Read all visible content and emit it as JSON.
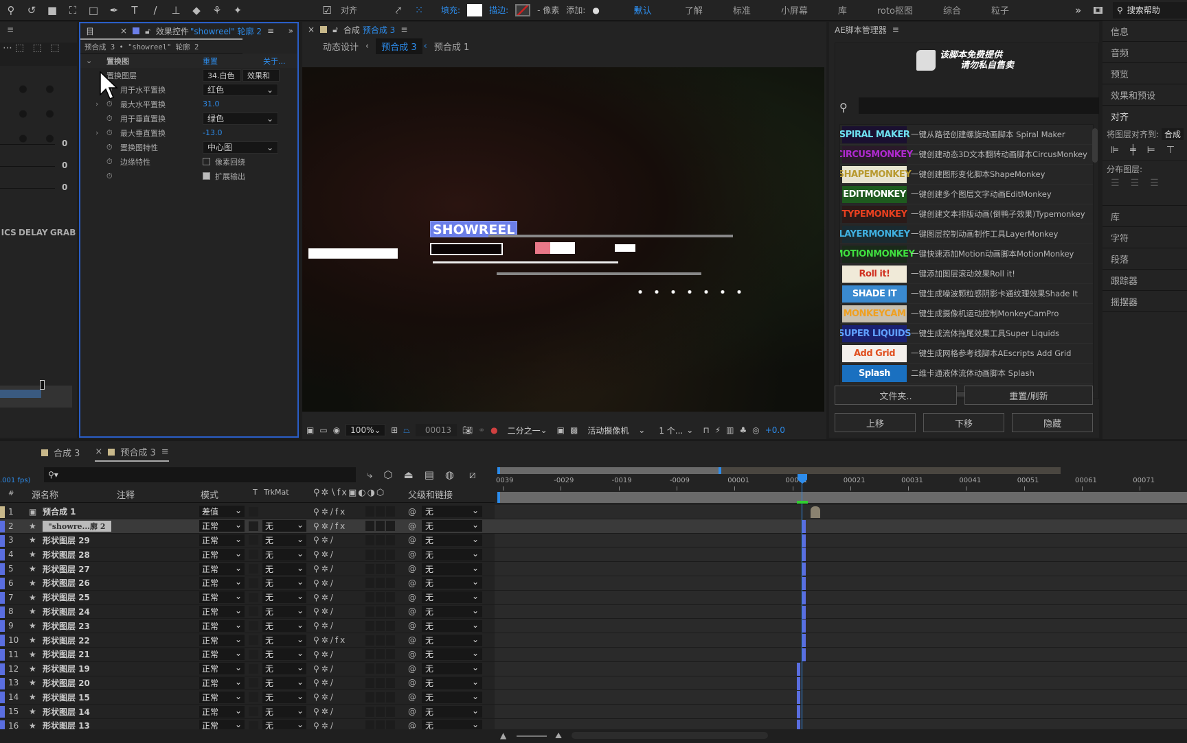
{
  "toolbar": {
    "align_label": "对齐",
    "fill_label": "填充:",
    "stroke_label": "描边:",
    "stroke_unit": "- 像素",
    "add_label": "添加:",
    "workspaces": [
      "默认",
      "了解",
      "标准",
      "小屏幕",
      "库",
      "roto抠图",
      "综合",
      "粒子"
    ],
    "active_workspace": "默认",
    "more": "»",
    "search_placeholder": "搜索帮助"
  },
  "left_panel": {
    "values": [
      "0",
      "0",
      "0"
    ],
    "buttons": [
      "ICS",
      "DELAY",
      "GRAB"
    ]
  },
  "effects_panel": {
    "tab_title": "效果控件",
    "tab_layer": "\"showreel\" 轮廓 2",
    "breadcrumb": "预合成 3 • \"showreel\" 轮廓 2",
    "effect_name": "置换图",
    "reset": "重置",
    "about": "关于...",
    "props": [
      {
        "label": "置换图层",
        "value": "34.白色",
        "value2": "效果和",
        "type": "dd2"
      },
      {
        "label": "用于水平置换",
        "value": "红色",
        "type": "dd"
      },
      {
        "label": "最大水平置换",
        "value": "31.0",
        "type": "num"
      },
      {
        "label": "用于垂直置换",
        "value": "绿色",
        "type": "dd"
      },
      {
        "label": "最大垂直置换",
        "value": "-13.0",
        "type": "num"
      },
      {
        "label": "置换图特性",
        "value": "中心图",
        "type": "dd"
      },
      {
        "label": "边缘特性",
        "value": "像素回绕",
        "type": "cb",
        "checked": false
      },
      {
        "label": "",
        "value": "扩展输出",
        "type": "cb",
        "checked": true
      }
    ]
  },
  "comp_panel": {
    "tab_prefix": "合成",
    "tab_name": "预合成 3",
    "breadcrumbs": [
      "动态设计",
      "预合成 3",
      "预合成 1"
    ],
    "showreel_text": "SHOWREEL",
    "zoom": "100%",
    "timecode": "00013",
    "resolution": "二分之一",
    "camera": "活动摄像机",
    "views": "1 个...",
    "exposure": "+0.0"
  },
  "script_manager": {
    "title": "AE脚本管理器",
    "banner_line1": "该脚本免费提供",
    "banner_line2": "请勿私自售卖",
    "search_value": "",
    "items": [
      {
        "thumb": "SPIRAL MAKER",
        "thumb_bg": "#1a1030",
        "thumb_fg": "#6ee0f0",
        "desc": "一键从路径创建螺旋动画脚本 Spiral Maker"
      },
      {
        "thumb": "CIRCUSMONKEY",
        "thumb_bg": "#2a1a2a",
        "thumb_fg": "#b02ad0",
        "desc": "一键创建动态3D文本翻转动画脚本CircusMonkey"
      },
      {
        "thumb": "SHAPEMONKEY",
        "thumb_bg": "#e8e4d0",
        "thumb_fg": "#b89a30",
        "desc": "一键创建图形变化脚本ShapeMonkey"
      },
      {
        "thumb": "EDITMONKEY",
        "thumb_bg": "#1e5a1e",
        "thumb_fg": "#ffffff",
        "desc": "一键创建多个图层文字动画EditMonkey"
      },
      {
        "thumb": "TYPEMONKEY",
        "thumb_bg": "#2a1a18",
        "thumb_fg": "#e84020",
        "desc": "一键创建文本排版动画(倒鸭子效果)Typemonkey"
      },
      {
        "thumb": "LAYERMONKEY",
        "thumb_bg": "#1a2a30",
        "thumb_fg": "#40b0e0",
        "desc": "一键图层控制动画制作工具LayerMonkey"
      },
      {
        "thumb": "MOTIONMONKEY",
        "thumb_bg": "#1a2a1a",
        "thumb_fg": "#40e040",
        "desc": "一键快速添加Motion动画脚本MotionMonkey"
      },
      {
        "thumb": "Roll it!",
        "thumb_bg": "#f0ead8",
        "thumb_fg": "#d03020",
        "desc": "一键添加图层滚动效果Roll it!"
      },
      {
        "thumb": "SHADE IT",
        "thumb_bg": "#3a8ad0",
        "thumb_fg": "#ffffff",
        "desc": "一键生成噪波颗粒感阴影卡通纹理效果Shade It"
      },
      {
        "thumb": "MONKEYCAM",
        "thumb_bg": "#c8c0b0",
        "thumb_fg": "#f0a020",
        "desc": "一键生成摄像机运动控制MonkeyCamPro"
      },
      {
        "thumb": "SUPER LIQUIDS",
        "thumb_bg": "#1a2070",
        "thumb_fg": "#60a0ff",
        "desc": "一键生成流体拖尾效果工具Super Liquids"
      },
      {
        "thumb": "Add Grid",
        "thumb_bg": "#f4f0ec",
        "thumb_fg": "#e05020",
        "desc": "一键生成网格参考线脚本AEscripts Add Grid"
      },
      {
        "thumb": "Splash",
        "thumb_bg": "#1a70c0",
        "thumb_fg": "#ffffff",
        "desc": "二维卡通液体流体动画脚本 Splash"
      }
    ],
    "buttons": {
      "folder": "文件夹..",
      "reset": "重置/刷新",
      "up": "上移",
      "down": "下移",
      "hide": "隐藏"
    }
  },
  "right_panel": {
    "items_top": [
      "信息",
      "音频",
      "预览",
      "效果和预设"
    ],
    "align_title": "对齐",
    "align_to_label": "将图层对齐到:",
    "align_to_value": "合成",
    "distribute_label": "分布图层:",
    "items_bottom": [
      "库",
      "字符",
      "段落",
      "跟踪器",
      "摇摆器"
    ]
  },
  "timeline": {
    "tabs": [
      {
        "label": "合成 3",
        "active": false
      },
      {
        "label": "预合成 3",
        "active": true
      }
    ],
    "fps": ".001 fps)",
    "search_value": "",
    "columns": {
      "num": "#",
      "source": "源名称",
      "comment": "注释",
      "mode": "模式",
      "t": "T",
      "trkmat": "TrkMat",
      "parent": "父级和链接"
    },
    "ruler": [
      "0039",
      "-0029",
      "-0019",
      "-0009",
      "00001",
      "00011",
      "00021",
      "00031",
      "00041",
      "00051",
      "00061",
      "00071"
    ],
    "current_frame": "00013",
    "layers": [
      {
        "num": "1",
        "name": "预合成 1",
        "mode": "差值",
        "trkmat": "",
        "fx": true,
        "parent": "无",
        "type": "comp"
      },
      {
        "num": "2",
        "name": "\"showre...廓 2",
        "mode": "正常",
        "trkmat": "无",
        "fx": true,
        "parent": "无",
        "type": "shape",
        "selected": true
      },
      {
        "num": "3",
        "name": "形状图层 29",
        "mode": "正常",
        "trkmat": "无",
        "fx": false,
        "parent": "无",
        "type": "shape"
      },
      {
        "num": "4",
        "name": "形状图层 28",
        "mode": "正常",
        "trkmat": "无",
        "fx": false,
        "parent": "无",
        "type": "shape"
      },
      {
        "num": "5",
        "name": "形状图层 27",
        "mode": "正常",
        "trkmat": "无",
        "fx": false,
        "parent": "无",
        "type": "shape"
      },
      {
        "num": "6",
        "name": "形状图层 26",
        "mode": "正常",
        "trkmat": "无",
        "fx": false,
        "parent": "无",
        "type": "shape"
      },
      {
        "num": "7",
        "name": "形状图层 25",
        "mode": "正常",
        "trkmat": "无",
        "fx": false,
        "parent": "无",
        "type": "shape"
      },
      {
        "num": "8",
        "name": "形状图层 24",
        "mode": "正常",
        "trkmat": "无",
        "fx": false,
        "parent": "无",
        "type": "shape"
      },
      {
        "num": "9",
        "name": "形状图层 23",
        "mode": "正常",
        "trkmat": "无",
        "fx": false,
        "parent": "无",
        "type": "shape"
      },
      {
        "num": "10",
        "name": "形状图层 22",
        "mode": "正常",
        "trkmat": "无",
        "fx": true,
        "parent": "无",
        "type": "shape"
      },
      {
        "num": "11",
        "name": "形状图层 21",
        "mode": "正常",
        "trkmat": "无",
        "fx": false,
        "parent": "无",
        "type": "shape"
      },
      {
        "num": "12",
        "name": "形状图层 19",
        "mode": "正常",
        "trkmat": "无",
        "fx": false,
        "parent": "无",
        "type": "shape"
      },
      {
        "num": "13",
        "name": "形状图层 20",
        "mode": "正常",
        "trkmat": "无",
        "fx": false,
        "parent": "无",
        "type": "shape"
      },
      {
        "num": "14",
        "name": "形状图层 15",
        "mode": "正常",
        "trkmat": "无",
        "fx": false,
        "parent": "无",
        "type": "shape"
      },
      {
        "num": "15",
        "name": "形状图层 14",
        "mode": "正常",
        "trkmat": "无",
        "fx": false,
        "parent": "无",
        "type": "shape"
      },
      {
        "num": "16",
        "name": "形状图层 13",
        "mode": "正常",
        "trkmat": "无",
        "fx": false,
        "parent": "无",
        "type": "shape"
      }
    ]
  },
  "colors": {
    "accent": "#2d8ceb",
    "label_blue": "#5a6ee0",
    "panel": "#232323",
    "selected_border": "#3a6ee0"
  }
}
